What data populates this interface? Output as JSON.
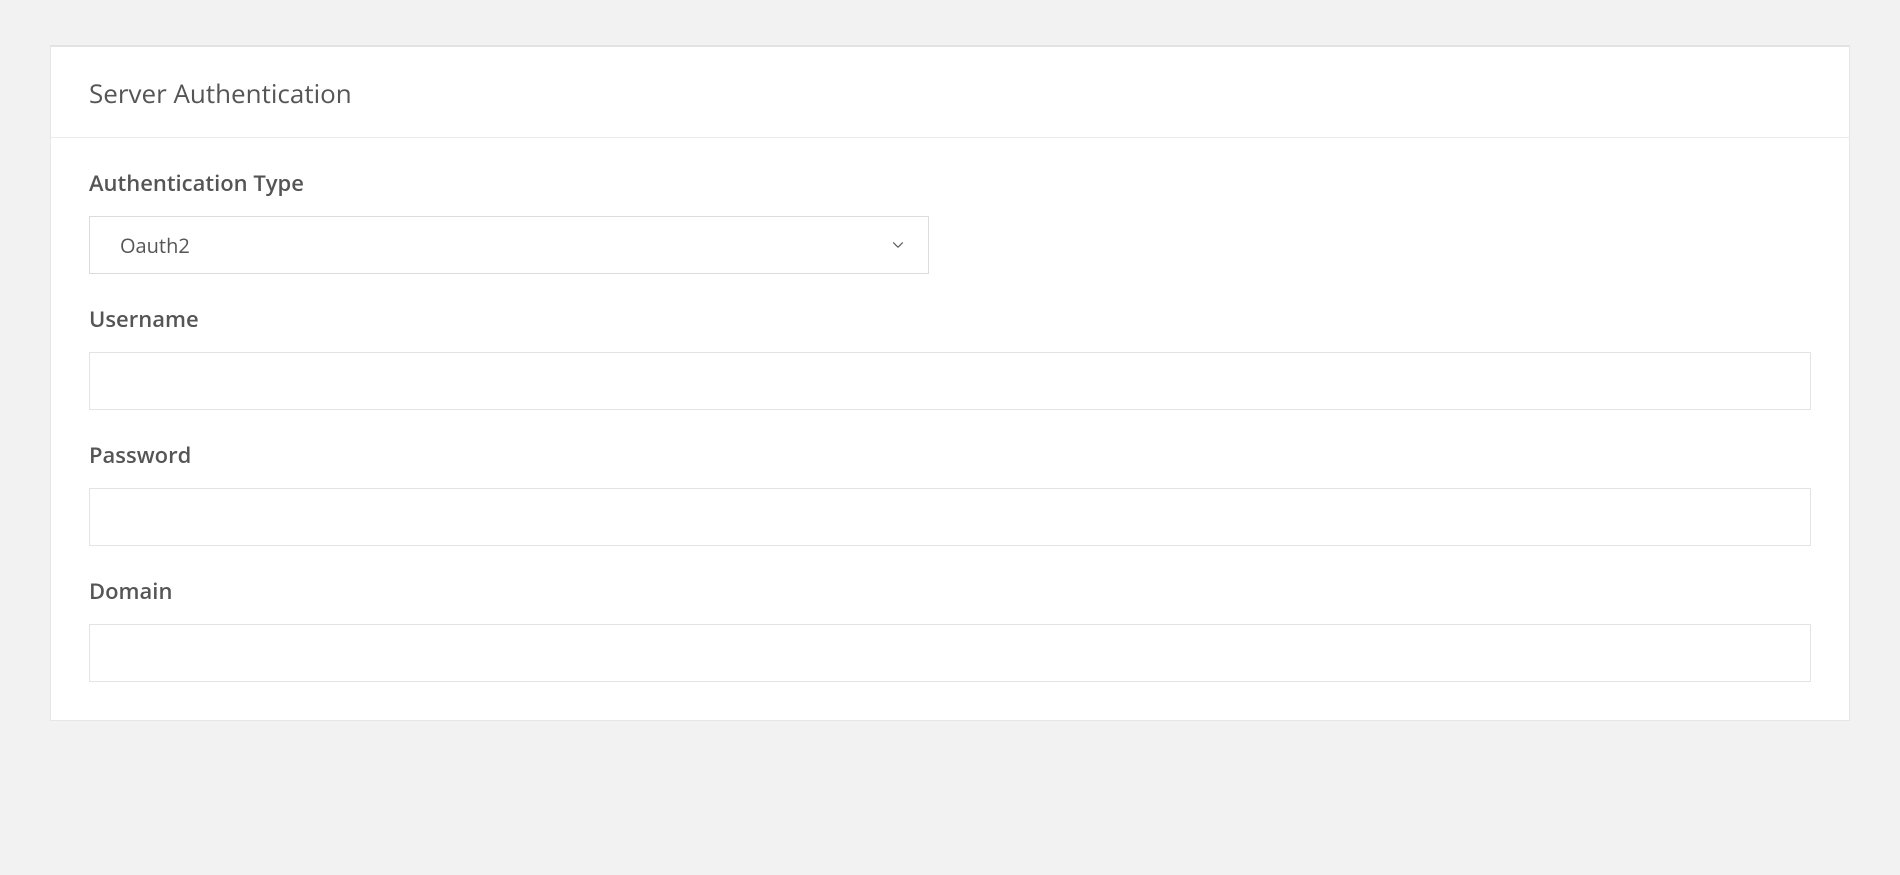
{
  "panel": {
    "title": "Server Authentication"
  },
  "form": {
    "auth_type": {
      "label": "Authentication Type",
      "value": "Oauth2"
    },
    "username": {
      "label": "Username",
      "value": ""
    },
    "password": {
      "label": "Password",
      "value": ""
    },
    "domain": {
      "label": "Domain",
      "value": ""
    }
  }
}
